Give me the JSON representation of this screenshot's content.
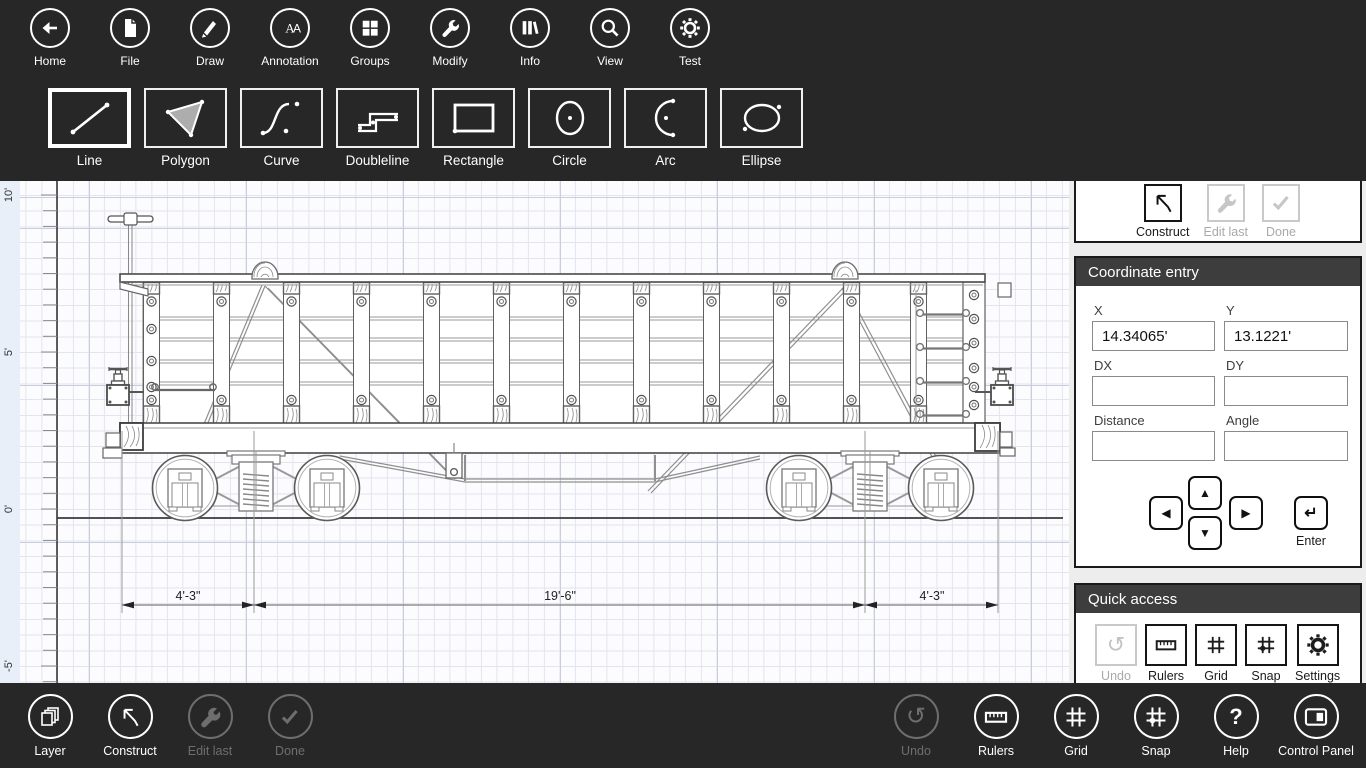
{
  "colors": {
    "bar_bg": "#272727",
    "panel_header_bg": "#3d3d3d",
    "ruler_bg": "#e9eff9",
    "grid_line": "#e2e5ee",
    "disabled_text": "#a9a9a9",
    "polygon_fill": "#adadad"
  },
  "topbar": {
    "items": [
      {
        "label": "Home",
        "icon": "back-arrow-icon"
      },
      {
        "label": "File",
        "icon": "file-icon"
      },
      {
        "label": "Draw",
        "icon": "pencil-icon"
      },
      {
        "label": "Annotation",
        "icon": "annotation-aa-icon"
      },
      {
        "label": "Groups",
        "icon": "tiles-icon"
      },
      {
        "label": "Modify",
        "icon": "wrench-icon"
      },
      {
        "label": "Info",
        "icon": "books-icon"
      },
      {
        "label": "View",
        "icon": "magnifier-icon"
      },
      {
        "label": "Test",
        "icon": "gear-icon"
      }
    ]
  },
  "tools": {
    "selected": "Line",
    "items": [
      {
        "label": "Line",
        "icon": "line-tool-icon"
      },
      {
        "label": "Polygon",
        "icon": "polygon-tool-icon"
      },
      {
        "label": "Curve",
        "icon": "curve-tool-icon"
      },
      {
        "label": "Doubleline",
        "icon": "doubleline-tool-icon"
      },
      {
        "label": "Rectangle",
        "icon": "rectangle-tool-icon"
      },
      {
        "label": "Circle",
        "icon": "circle-tool-icon"
      },
      {
        "label": "Arc",
        "icon": "arc-tool-icon"
      },
      {
        "label": "Ellipse",
        "icon": "ellipse-tool-icon"
      }
    ]
  },
  "canvas": {
    "ruler_labels": {
      "l0": "10'",
      "l1": "5'",
      "l2": "0'",
      "l3": "-5'"
    },
    "dimensions": {
      "d0": "4'-3\"",
      "d1": "19'-6\"",
      "d2": "4'-3\""
    }
  },
  "construct_panel": {
    "buttons": [
      {
        "label": "Construct",
        "icon": "construct-arrow-icon",
        "enabled": true
      },
      {
        "label": "Edit last",
        "icon": "wrench-icon",
        "enabled": false
      },
      {
        "label": "Done",
        "icon": "check-icon",
        "enabled": false
      }
    ]
  },
  "coordinate_entry": {
    "title": "Coordinate entry",
    "fields": [
      {
        "label": "X",
        "value": "14.34065'"
      },
      {
        "label": "Y",
        "value": "13.1221'"
      },
      {
        "label": "DX",
        "value": ""
      },
      {
        "label": "DY",
        "value": ""
      },
      {
        "label": "Distance",
        "value": ""
      },
      {
        "label": "Angle",
        "value": ""
      }
    ],
    "keypad": {
      "up": "▲",
      "down": "▼",
      "left": "◀",
      "right": "▶",
      "enter_glyph": "↵",
      "enter_label": "Enter"
    }
  },
  "quick_access": {
    "title": "Quick access",
    "buttons": [
      {
        "label": "Undo",
        "icon": "undo-icon",
        "enabled": false
      },
      {
        "label": "Rulers",
        "icon": "ruler-icon",
        "enabled": true
      },
      {
        "label": "Grid",
        "icon": "grid-icon",
        "enabled": true
      },
      {
        "label": "Snap",
        "icon": "snap-icon",
        "enabled": true
      },
      {
        "label": "Settings",
        "icon": "gear-icon",
        "enabled": true
      }
    ]
  },
  "bottombar": {
    "left": [
      {
        "label": "Layer",
        "icon": "layers-icon",
        "enabled": true
      },
      {
        "label": "Construct",
        "icon": "construct-arrow-icon",
        "enabled": true
      },
      {
        "label": "Edit last",
        "icon": "wrench-icon",
        "enabled": false
      },
      {
        "label": "Done",
        "icon": "check-icon",
        "enabled": false
      }
    ],
    "right": [
      {
        "label": "Undo",
        "icon": "undo-icon",
        "enabled": false
      },
      {
        "label": "Rulers",
        "icon": "ruler-icon",
        "enabled": true
      },
      {
        "label": "Grid",
        "icon": "grid-icon",
        "enabled": true
      },
      {
        "label": "Snap",
        "icon": "snap-icon",
        "enabled": true
      },
      {
        "label": "Help",
        "icon": "question-icon",
        "enabled": true
      },
      {
        "label": "Control Panel",
        "icon": "control-panel-icon",
        "enabled": true
      }
    ]
  }
}
